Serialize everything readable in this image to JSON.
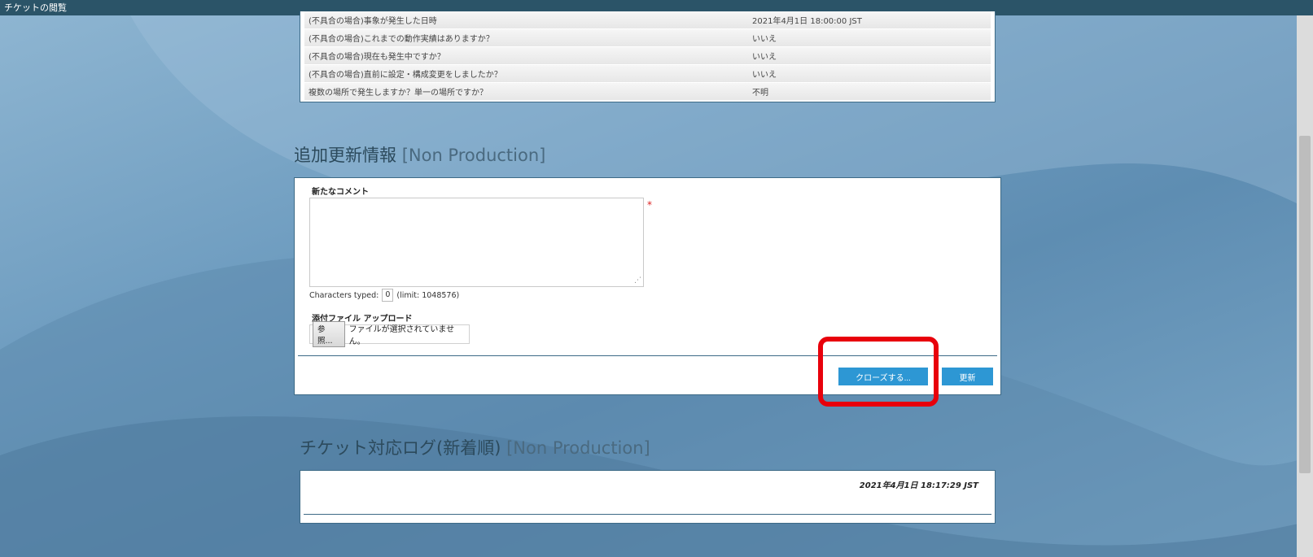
{
  "window": {
    "title": "チケットの閲覧"
  },
  "questions": [
    {
      "q": "(不具合の場合)事象が発生した日時",
      "a": "2021年4月1日 18:00:00 JST"
    },
    {
      "q": "(不具合の場合)これまでの動作実績はありますか？",
      "a": "いいえ"
    },
    {
      "q": "(不具合の場合)現在も発生中ですか？",
      "a": "いいえ"
    },
    {
      "q": "(不具合の場合)直前に設定・構成変更をしましたか？",
      "a": "いいえ"
    },
    {
      "q": "複数の場所で発生しますか？単一の場所ですか？",
      "a": "不明"
    }
  ],
  "update_section": {
    "title": "追加更新情報",
    "env_tag": "[Non Production]",
    "comment_label": "新たなコメント",
    "required_mark": "*",
    "chars_typed_label": "Characters typed:",
    "chars_typed_value": "0",
    "chars_limit": "(limit: 1048576)",
    "attachment_label": "添付ファイル アップロード",
    "browse_label": "参照...",
    "no_file_text": "ファイルが選択されていません。",
    "close_button": "クローズする...",
    "update_button": "更新"
  },
  "log_section": {
    "title": "チケット対応ログ(新着順)",
    "env_tag": "[Non Production]",
    "entry_date": "2021年4月1日 18:17:29 JST"
  },
  "colors": {
    "accent": "#2d97d4",
    "highlight": "#e8000b",
    "titlebar": "#2b5468"
  }
}
